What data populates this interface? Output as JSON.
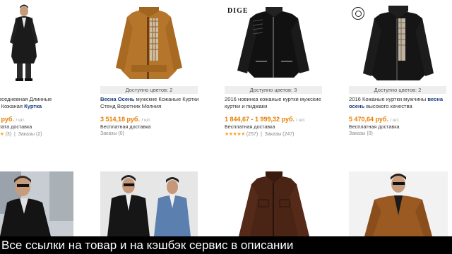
{
  "products": [
    {
      "title_plain": "овседневная Длинные",
      "title_line2_plain": "ы Кожаная ",
      "title_bold": "Куртка",
      "price": "5 руб.",
      "unit": "/ шт.",
      "shipping": "плата доставка",
      "stars": "★★",
      "reviews": "(3)",
      "orders": "Заказы (2)"
    },
    {
      "colors": "Доступно цветов: 2",
      "title_bold": "Весна Осень",
      "title_plain": " мужские Кожаные Куртки Стенд Воротник Молния",
      "price": "3 514,18 руб.",
      "unit": "/ шт.",
      "shipping": "Бесплатная доставка",
      "orders": "Заказы (0)"
    },
    {
      "brand": "DIGE",
      "colors": "Доступно цветов: 3",
      "title_plain": "2016 новинка кожаные куртки мужские куртки и пиджаки",
      "price": "1 844,67 - 1 999,32 руб.",
      "unit": "/ шт.",
      "shipping": "Бесплатная доставка",
      "stars": "★★★★★",
      "reviews": "(257)",
      "orders": "Заказы (247)"
    },
    {
      "colors": "Доступно цветов: 2",
      "title_plain": "2016 Кожаные куртки мужчины ",
      "title_bold": "весна осень",
      "title_plain2": " высокого качества",
      "price": "5 470,64 руб.",
      "unit": "/ шт.",
      "shipping": "Бесплатная доставка",
      "orders": "Заказы (0)"
    }
  ],
  "caption": "Все ссылки на товар и на кэшбэк сервис в описании",
  "colors": {
    "price": "#e67e00",
    "link": "#1a3d7c",
    "star": "#f5a623",
    "caption_bg": "#000000"
  }
}
